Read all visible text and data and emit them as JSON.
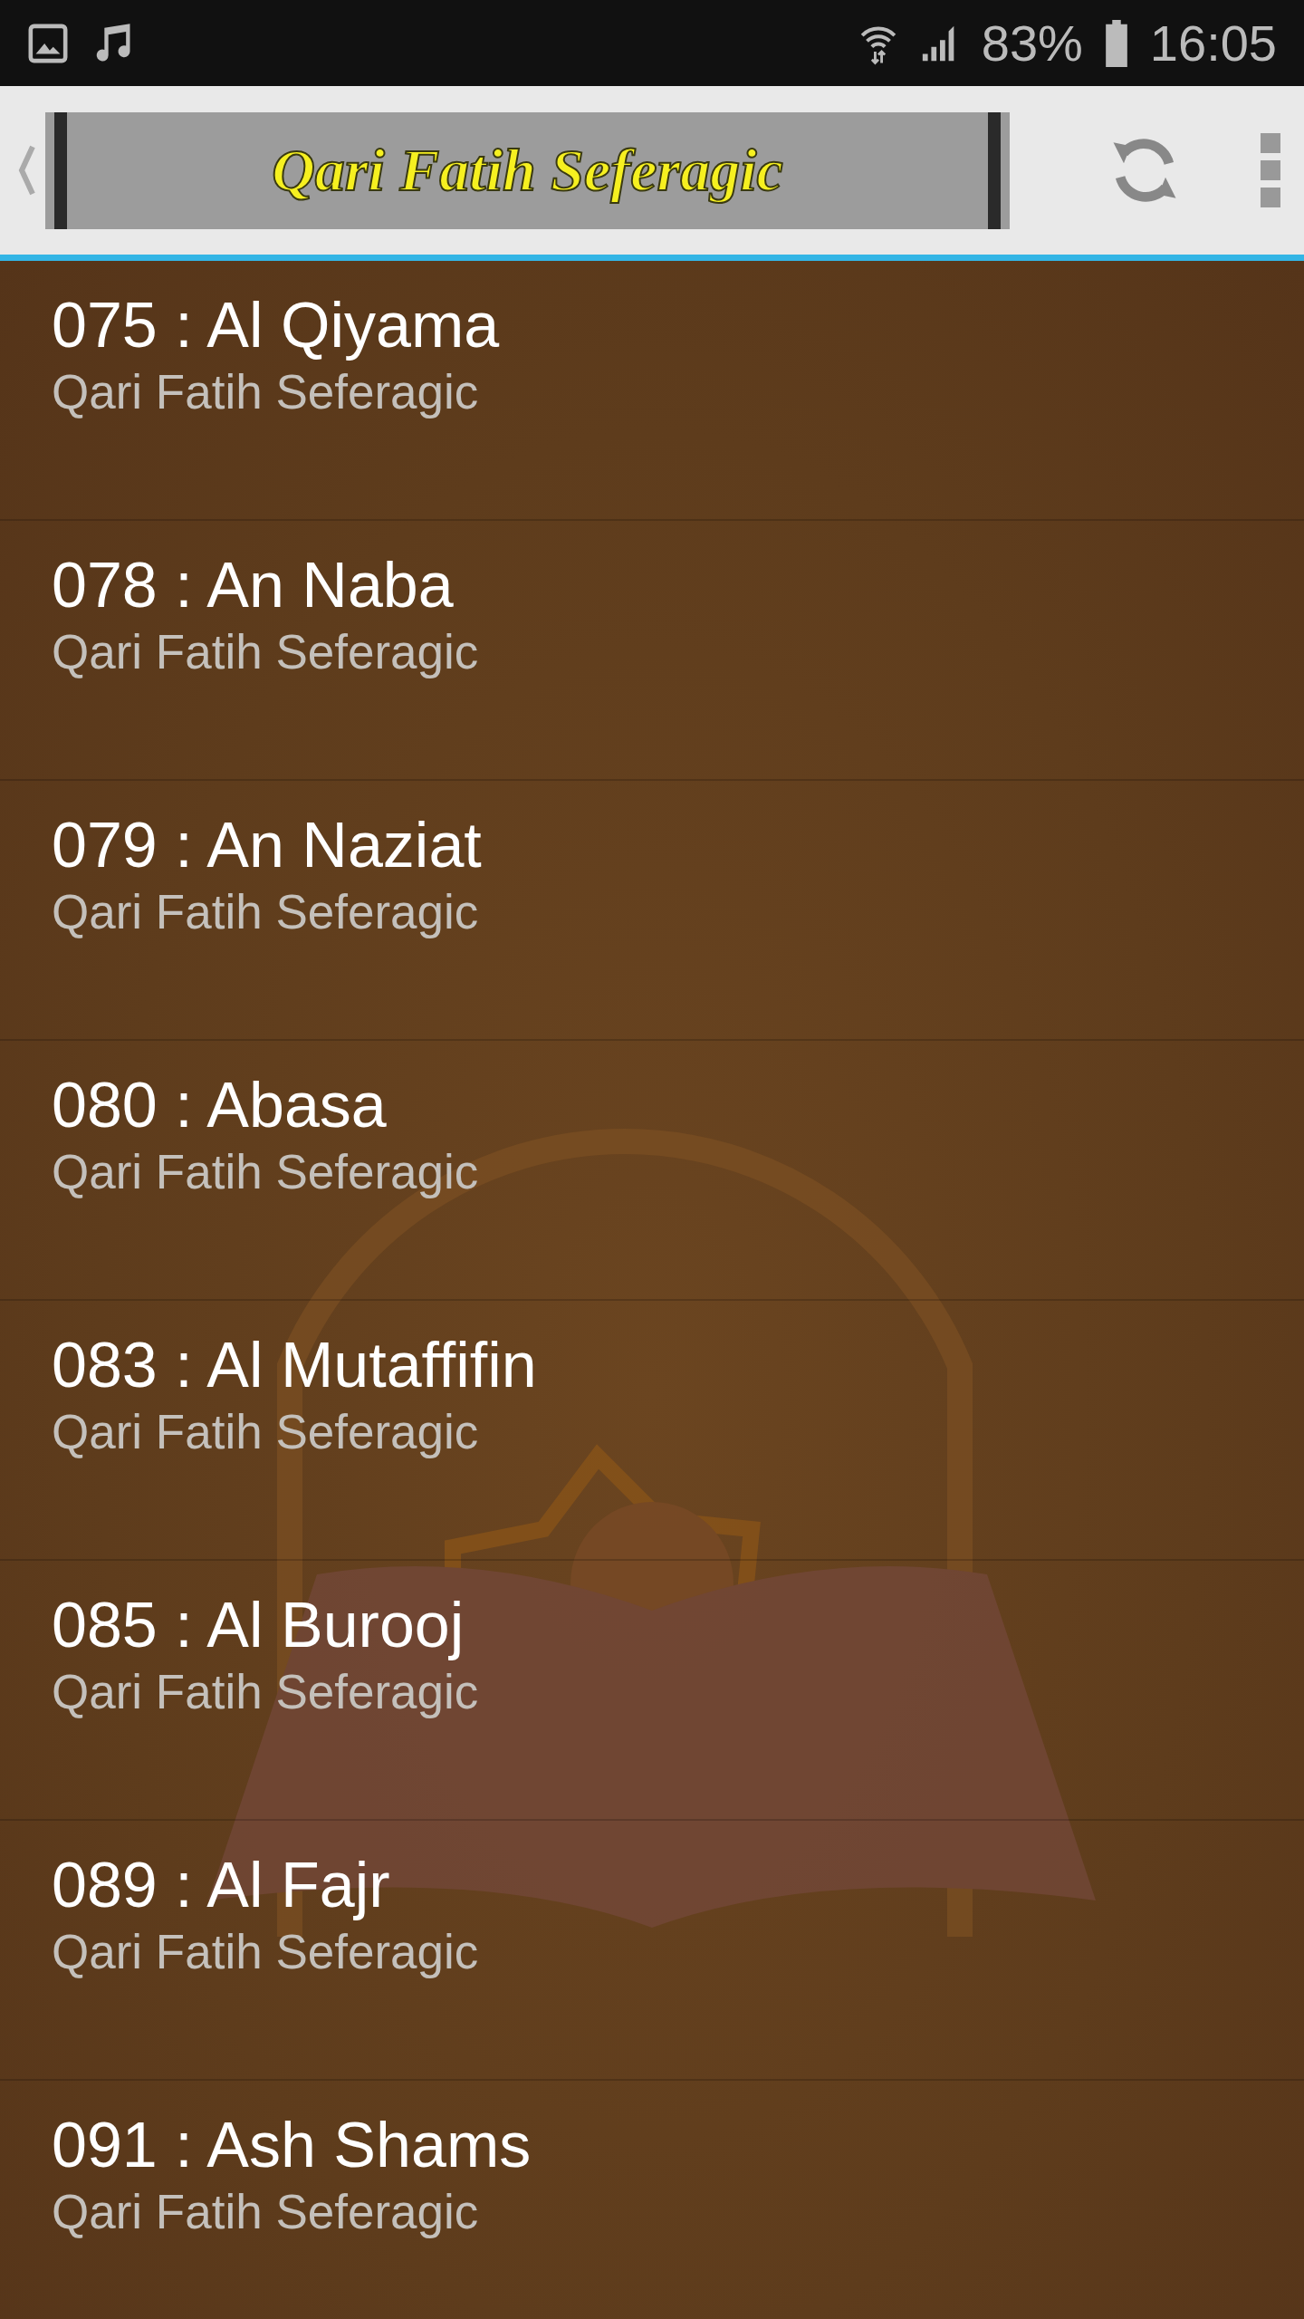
{
  "status_bar": {
    "battery": "83%",
    "time": "16:05"
  },
  "action_bar": {
    "title": "Qari Fatih Seferagic"
  },
  "items": [
    {
      "title": "075 : Al Qiyama",
      "subtitle": "Qari Fatih Seferagic"
    },
    {
      "title": "078 : An Naba",
      "subtitle": "Qari Fatih Seferagic"
    },
    {
      "title": "079 : An Naziat",
      "subtitle": "Qari Fatih Seferagic"
    },
    {
      "title": "080 : Abasa",
      "subtitle": "Qari Fatih Seferagic"
    },
    {
      "title": "083 : Al Mutaffifin",
      "subtitle": "Qari Fatih Seferagic"
    },
    {
      "title": "085 : Al Burooj",
      "subtitle": "Qari Fatih Seferagic"
    },
    {
      "title": "089 : Al Fajr",
      "subtitle": "Qari Fatih Seferagic"
    },
    {
      "title": "091 : Ash Shams",
      "subtitle": "Qari Fatih Seferagic"
    }
  ]
}
